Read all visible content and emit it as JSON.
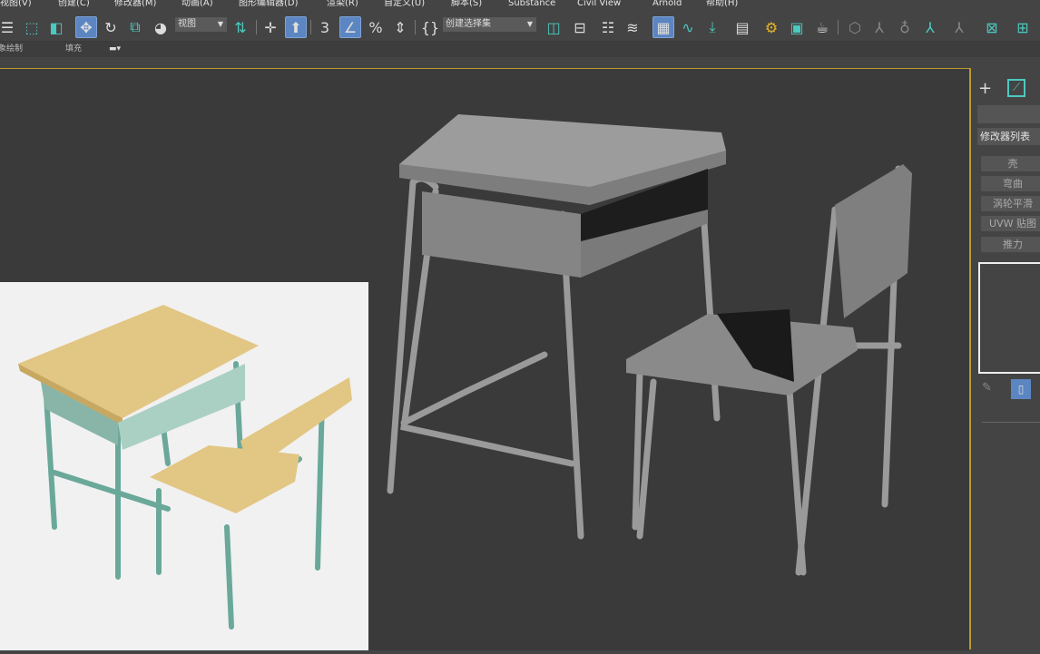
{
  "menu": [
    "视图(V)",
    "创建(C)",
    "修改器(M)",
    "动画(A)",
    "图形编辑器(D)",
    "渲染(R)",
    "自定义(U)",
    "脚本(S)",
    "Substance",
    "Civil View",
    "Arnold",
    "帮助(H)"
  ],
  "toolbar": {
    "view_dropdown": "视图",
    "selection_set_dropdown": "创建选择集"
  },
  "ribbon": {
    "item1": "象绘制",
    "item2": "填充"
  },
  "panel": {
    "modifier_list": "修改器列表",
    "modifiers": [
      "壳",
      "弯曲",
      "涡轮平滑",
      "UVW 贴图",
      "推力"
    ]
  },
  "colors": {
    "accent": "#5b86c2",
    "viewport_border": "#b89a2e",
    "icon_teal": "#4cc9c0"
  }
}
